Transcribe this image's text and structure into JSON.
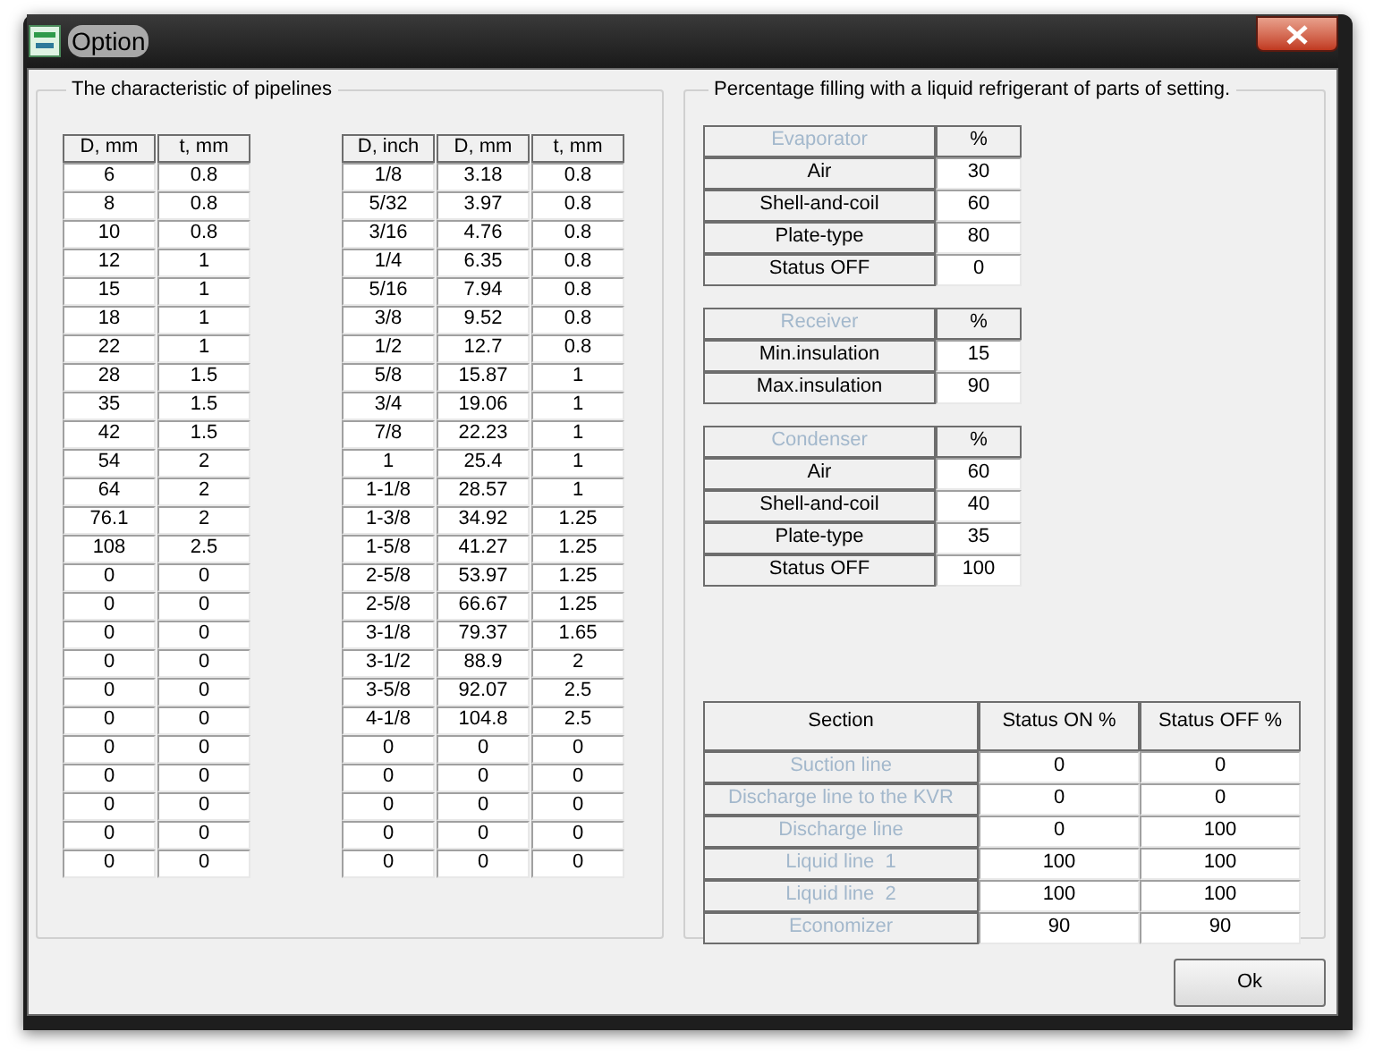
{
  "window": {
    "title": "Option"
  },
  "pipelines": {
    "title": "The characteristic of pipelines",
    "tables": [
      {
        "columns": [
          "D, mm",
          "t, mm"
        ],
        "rows": [
          [
            "6",
            "0.8"
          ],
          [
            "8",
            "0.8"
          ],
          [
            "10",
            "0.8"
          ],
          [
            "12",
            "1"
          ],
          [
            "15",
            "1"
          ],
          [
            "18",
            "1"
          ],
          [
            "22",
            "1"
          ],
          [
            "28",
            "1.5"
          ],
          [
            "35",
            "1.5"
          ],
          [
            "42",
            "1.5"
          ],
          [
            "54",
            "2"
          ],
          [
            "64",
            "2"
          ],
          [
            "76.1",
            "2"
          ],
          [
            "108",
            "2.5"
          ],
          [
            "0",
            "0"
          ],
          [
            "0",
            "0"
          ],
          [
            "0",
            "0"
          ],
          [
            "0",
            "0"
          ],
          [
            "0",
            "0"
          ],
          [
            "0",
            "0"
          ],
          [
            "0",
            "0"
          ],
          [
            "0",
            "0"
          ],
          [
            "0",
            "0"
          ],
          [
            "0",
            "0"
          ],
          [
            "0",
            "0"
          ]
        ]
      },
      {
        "columns": [
          "D, inch",
          "D, mm",
          "t, mm"
        ],
        "rows": [
          [
            "1/8",
            "3.18",
            "0.8"
          ],
          [
            "5/32",
            "3.97",
            "0.8"
          ],
          [
            "3/16",
            "4.76",
            "0.8"
          ],
          [
            "1/4",
            "6.35",
            "0.8"
          ],
          [
            "5/16",
            "7.94",
            "0.8"
          ],
          [
            "3/8",
            "9.52",
            "0.8"
          ],
          [
            "1/2",
            "12.7",
            "0.8"
          ],
          [
            "5/8",
            "15.87",
            "1"
          ],
          [
            "3/4",
            "19.06",
            "1"
          ],
          [
            "7/8",
            "22.23",
            "1"
          ],
          [
            "1",
            "25.4",
            "1"
          ],
          [
            "1-1/8",
            "28.57",
            "1"
          ],
          [
            "1-3/8",
            "34.92",
            "1.25"
          ],
          [
            "1-5/8",
            "41.27",
            "1.25"
          ],
          [
            "2-5/8",
            "53.97",
            "1.25"
          ],
          [
            "2-5/8",
            "66.67",
            "1.25"
          ],
          [
            "3-1/8",
            "79.37",
            "1.65"
          ],
          [
            "3-1/2",
            "88.9",
            "2"
          ],
          [
            "3-5/8",
            "92.07",
            "2.5"
          ],
          [
            "4-1/8",
            "104.8",
            "2.5"
          ],
          [
            "0",
            "0",
            "0"
          ],
          [
            "0",
            "0",
            "0"
          ],
          [
            "0",
            "0",
            "0"
          ],
          [
            "0",
            "0",
            "0"
          ],
          [
            "0",
            "0",
            "0"
          ]
        ]
      }
    ]
  },
  "filling": {
    "title": "Percentage filling with a liquid refrigerant of parts of setting.",
    "groups": [
      {
        "name": "Evaporator",
        "name_disabled": true,
        "unit": "%",
        "rows": [
          {
            "label": "Air",
            "value": "30"
          },
          {
            "label": "Shell-and-coil",
            "value": "60"
          },
          {
            "label": "Plate-type",
            "value": "80"
          },
          {
            "label": "Status OFF",
            "value": "0"
          }
        ]
      },
      {
        "name": "Receiver",
        "name_disabled": true,
        "unit": "%",
        "rows": [
          {
            "label": "Min.insulation",
            "value": "15"
          },
          {
            "label": "Max.insulation",
            "value": "90"
          }
        ]
      },
      {
        "name": "Condenser",
        "name_disabled": true,
        "unit": "%",
        "rows": [
          {
            "label": "Air",
            "value": "60"
          },
          {
            "label": "Shell-and-coil",
            "value": "40"
          },
          {
            "label": "Plate-type",
            "value": "35"
          },
          {
            "label": "Status OFF",
            "value": "100"
          }
        ]
      }
    ],
    "sections": {
      "columns": [
        "Section",
        "Status ON %",
        "Status OFF %"
      ],
      "rows": [
        {
          "name": "Suction line",
          "disabled": true,
          "on": "0",
          "off": "0"
        },
        {
          "name": "Discharge line to the KVR",
          "disabled": true,
          "on": "0",
          "off": "0"
        },
        {
          "name": "Discharge line",
          "disabled": true,
          "on": "0",
          "off": "100"
        },
        {
          "name": "Liquid line  1",
          "disabled": true,
          "on": "100",
          "off": "100"
        },
        {
          "name": "Liquid line  2",
          "disabled": true,
          "on": "100",
          "off": "100"
        },
        {
          "name": "Economizer",
          "disabled": true,
          "on": "90",
          "off": "90"
        }
      ]
    }
  },
  "buttons": [
    {
      "label": "Ok"
    }
  ]
}
